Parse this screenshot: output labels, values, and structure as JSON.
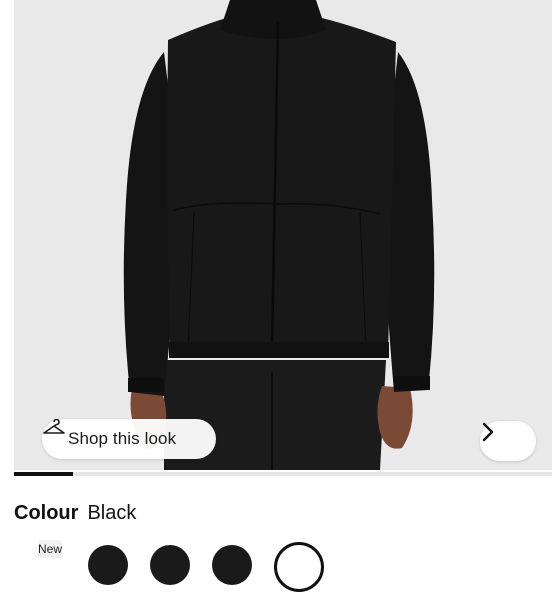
{
  "product_image": {
    "alt_icon": "product-photo",
    "carousel_progress": 0.11
  },
  "shop_look": {
    "label": "Shop this look",
    "icon": "hanger-icon"
  },
  "carousel": {
    "next_icon": "chevron-right-icon"
  },
  "colour": {
    "label": "Colour",
    "value": "Black",
    "badge": "New"
  },
  "colors": {
    "image_bg": "#e9e9ea",
    "jacket": "#161616",
    "progress": "#111111"
  }
}
